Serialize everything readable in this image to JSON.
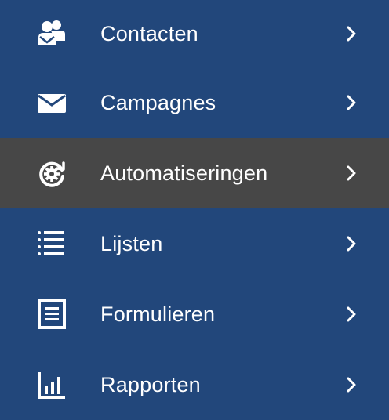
{
  "colors": {
    "sidebar_bg": "#22477b",
    "active_bg": "#474747",
    "text": "#ffffff"
  },
  "menu": {
    "items": [
      {
        "label": "Contacten",
        "icon": "contacts-icon",
        "active": false
      },
      {
        "label": "Campagnes",
        "icon": "envelope-icon",
        "active": false
      },
      {
        "label": "Automatiseringen",
        "icon": "automation-gear-icon",
        "active": true
      },
      {
        "label": "Lijsten",
        "icon": "list-icon",
        "active": false
      },
      {
        "label": "Formulieren",
        "icon": "form-icon",
        "active": false
      },
      {
        "label": "Rapporten",
        "icon": "bar-chart-icon",
        "active": false
      }
    ],
    "chevron_icon": "chevron-right-icon"
  }
}
